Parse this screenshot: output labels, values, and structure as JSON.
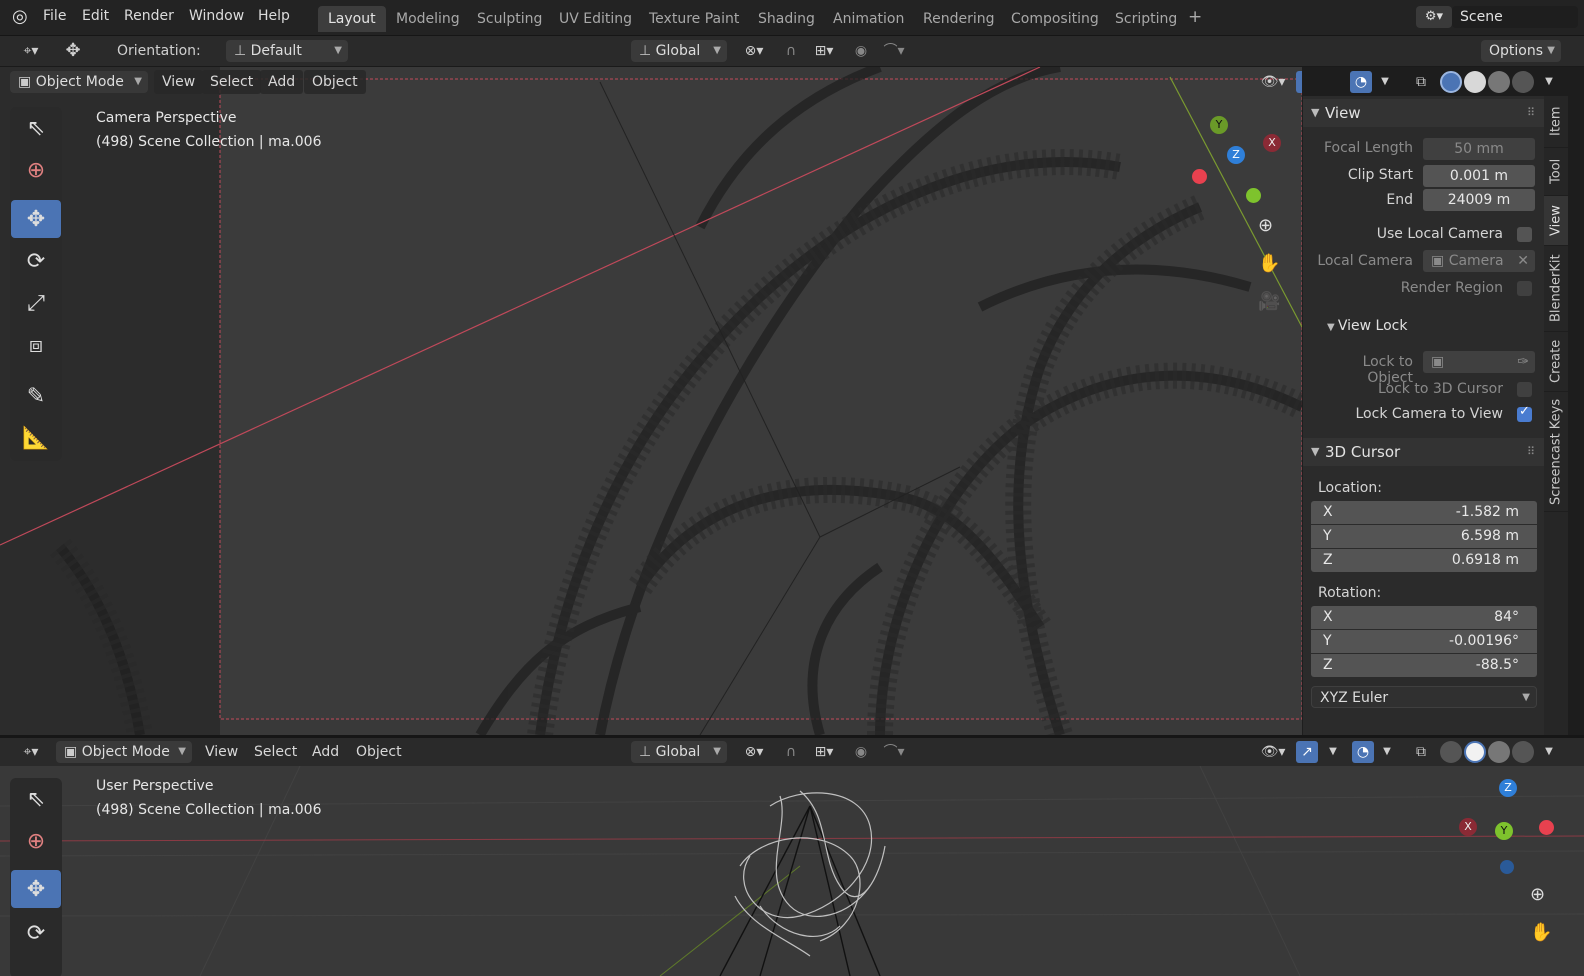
{
  "topbar": {
    "menus": [
      "File",
      "Edit",
      "Render",
      "Window",
      "Help"
    ],
    "workspaces": [
      "Layout",
      "Modeling",
      "Sculpting",
      "UV Editing",
      "Texture Paint",
      "Shading",
      "Animation",
      "Rendering",
      "Compositing",
      "Scripting"
    ],
    "add_tab": "+",
    "scene_label": "Scene"
  },
  "toolheader": {
    "orientation_label": "Orientation:",
    "orientation_value": "Default",
    "transform_space": "Global",
    "options_label": "Options"
  },
  "viewport_top": {
    "mode": "Object Mode",
    "menus": [
      "View",
      "Select",
      "Add",
      "Object"
    ],
    "perspective": "Camera Perspective",
    "collection": "(498) Scene Collection | ma.006",
    "gizmo_axes": [
      "Y",
      "Z",
      "X"
    ]
  },
  "npanel": {
    "view_section": {
      "title": "View",
      "focal_length_label": "Focal Length",
      "focal_length": "50 mm",
      "clip_start_label": "Clip Start",
      "clip_start": "0.001 m",
      "clip_end_label": "End",
      "clip_end": "24009 m",
      "use_local_camera_label": "Use Local Camera",
      "local_camera_label": "Local Camera",
      "local_camera_value": "Camera",
      "render_region_label": "Render Region"
    },
    "view_lock": {
      "title": "View Lock",
      "lock_to_object_label": "Lock to Object",
      "lock_3d_cursor_label": "Lock to 3D Cursor",
      "lock_camera_label": "Lock Camera to View",
      "lock_camera_checked": true
    },
    "cursor_section": {
      "title": "3D Cursor",
      "location_label": "Location:",
      "location": [
        {
          "axis": "X",
          "value": "-1.582 m"
        },
        {
          "axis": "Y",
          "value": "6.598 m"
        },
        {
          "axis": "Z",
          "value": "0.6918 m"
        }
      ],
      "rotation_label": "Rotation:",
      "rotation": [
        {
          "axis": "X",
          "value": "84°"
        },
        {
          "axis": "Y",
          "value": "-0.00196°"
        },
        {
          "axis": "Z",
          "value": "-88.5°"
        }
      ],
      "rotation_mode": "XYZ Euler"
    },
    "tabs": [
      "Item",
      "Tool",
      "View",
      "BlenderKit",
      "Create",
      "Screencast Keys"
    ]
  },
  "viewport_bottom": {
    "mode": "Object Mode",
    "menus": [
      "View",
      "Select",
      "Add",
      "Object"
    ],
    "transform_space": "Global",
    "perspective": "User Perspective",
    "collection": "(498) Scene Collection | ma.006",
    "gizmo_axes": [
      "Z",
      "X",
      "Y"
    ]
  },
  "colors": {
    "accent": "#4b74b4",
    "axis_x": "#e8414f",
    "axis_y": "#7ec32d",
    "axis_z": "#2f7fd8",
    "viewport_bg": "#393939"
  }
}
